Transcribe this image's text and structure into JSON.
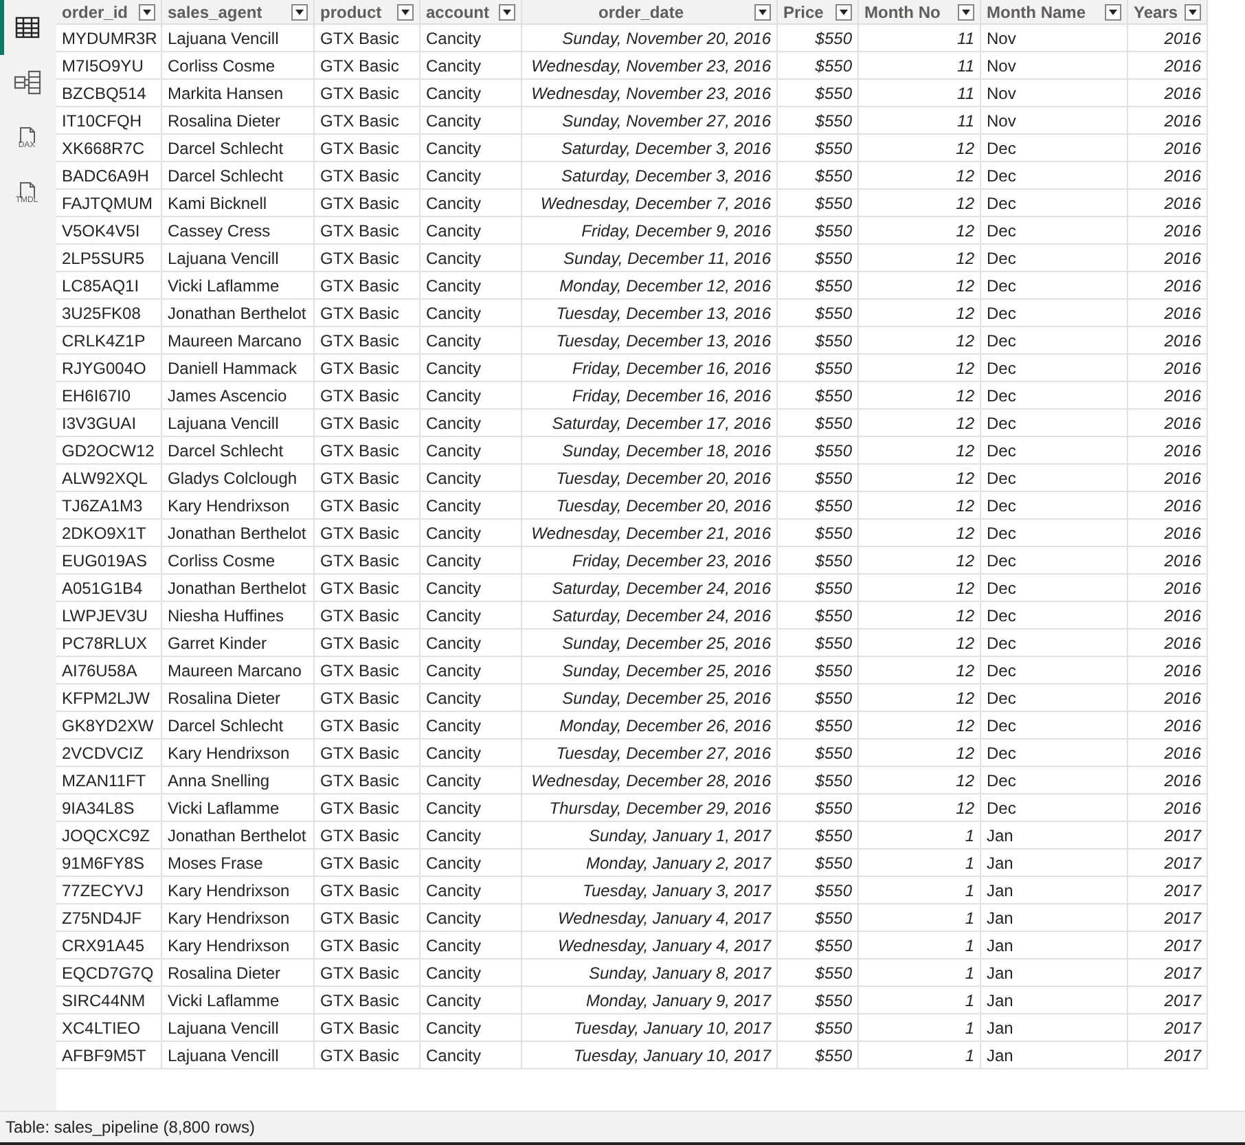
{
  "sidebar": {
    "items": [
      {
        "kind": "table",
        "selected": true
      },
      {
        "kind": "model",
        "selected": false
      },
      {
        "kind": "doc",
        "label": "DAX",
        "selected": false
      },
      {
        "kind": "doc",
        "label": "TMDL",
        "selected": false
      }
    ]
  },
  "table": {
    "columns": [
      {
        "name": "order_id",
        "kind": "text"
      },
      {
        "name": "sales_agent",
        "kind": "text"
      },
      {
        "name": "product",
        "kind": "text"
      },
      {
        "name": "account",
        "kind": "text"
      },
      {
        "name": "order_date",
        "kind": "date"
      },
      {
        "name": "Price",
        "kind": "number"
      },
      {
        "name": "Month No",
        "kind": "number"
      },
      {
        "name": "Month Name",
        "kind": "text"
      },
      {
        "name": "Years",
        "kind": "number"
      }
    ],
    "rows": [
      [
        "MYDUMR3R",
        "Lajuana Vencill",
        "GTX Basic",
        "Cancity",
        "Sunday, November 20, 2016",
        "$550",
        "11",
        "Nov",
        "2016"
      ],
      [
        "M7I5O9YU",
        "Corliss Cosme",
        "GTX Basic",
        "Cancity",
        "Wednesday, November 23, 2016",
        "$550",
        "11",
        "Nov",
        "2016"
      ],
      [
        "BZCBQ514",
        "Markita Hansen",
        "GTX Basic",
        "Cancity",
        "Wednesday, November 23, 2016",
        "$550",
        "11",
        "Nov",
        "2016"
      ],
      [
        "IT10CFQH",
        "Rosalina Dieter",
        "GTX Basic",
        "Cancity",
        "Sunday, November 27, 2016",
        "$550",
        "11",
        "Nov",
        "2016"
      ],
      [
        "XK668R7C",
        "Darcel Schlecht",
        "GTX Basic",
        "Cancity",
        "Saturday, December 3, 2016",
        "$550",
        "12",
        "Dec",
        "2016"
      ],
      [
        "BADC6A9H",
        "Darcel Schlecht",
        "GTX Basic",
        "Cancity",
        "Saturday, December 3, 2016",
        "$550",
        "12",
        "Dec",
        "2016"
      ],
      [
        "FAJTQMUM",
        "Kami Bicknell",
        "GTX Basic",
        "Cancity",
        "Wednesday, December 7, 2016",
        "$550",
        "12",
        "Dec",
        "2016"
      ],
      [
        "V5OK4V5I",
        "Cassey Cress",
        "GTX Basic",
        "Cancity",
        "Friday, December 9, 2016",
        "$550",
        "12",
        "Dec",
        "2016"
      ],
      [
        "2LP5SUR5",
        "Lajuana Vencill",
        "GTX Basic",
        "Cancity",
        "Sunday, December 11, 2016",
        "$550",
        "12",
        "Dec",
        "2016"
      ],
      [
        "LC85AQ1I",
        "Vicki Laflamme",
        "GTX Basic",
        "Cancity",
        "Monday, December 12, 2016",
        "$550",
        "12",
        "Dec",
        "2016"
      ],
      [
        "3U25FK08",
        "Jonathan Berthelot",
        "GTX Basic",
        "Cancity",
        "Tuesday, December 13, 2016",
        "$550",
        "12",
        "Dec",
        "2016"
      ],
      [
        "CRLK4Z1P",
        "Maureen Marcano",
        "GTX Basic",
        "Cancity",
        "Tuesday, December 13, 2016",
        "$550",
        "12",
        "Dec",
        "2016"
      ],
      [
        "RJYG004O",
        "Daniell Hammack",
        "GTX Basic",
        "Cancity",
        "Friday, December 16, 2016",
        "$550",
        "12",
        "Dec",
        "2016"
      ],
      [
        "EH6I67I0",
        "James Ascencio",
        "GTX Basic",
        "Cancity",
        "Friday, December 16, 2016",
        "$550",
        "12",
        "Dec",
        "2016"
      ],
      [
        "I3V3GUAI",
        "Lajuana Vencill",
        "GTX Basic",
        "Cancity",
        "Saturday, December 17, 2016",
        "$550",
        "12",
        "Dec",
        "2016"
      ],
      [
        "GD2OCW12",
        "Darcel Schlecht",
        "GTX Basic",
        "Cancity",
        "Sunday, December 18, 2016",
        "$550",
        "12",
        "Dec",
        "2016"
      ],
      [
        "ALW92XQL",
        "Gladys Colclough",
        "GTX Basic",
        "Cancity",
        "Tuesday, December 20, 2016",
        "$550",
        "12",
        "Dec",
        "2016"
      ],
      [
        "TJ6ZA1M3",
        "Kary Hendrixson",
        "GTX Basic",
        "Cancity",
        "Tuesday, December 20, 2016",
        "$550",
        "12",
        "Dec",
        "2016"
      ],
      [
        "2DKO9X1T",
        "Jonathan Berthelot",
        "GTX Basic",
        "Cancity",
        "Wednesday, December 21, 2016",
        "$550",
        "12",
        "Dec",
        "2016"
      ],
      [
        "EUG019AS",
        "Corliss Cosme",
        "GTX Basic",
        "Cancity",
        "Friday, December 23, 2016",
        "$550",
        "12",
        "Dec",
        "2016"
      ],
      [
        "A051G1B4",
        "Jonathan Berthelot",
        "GTX Basic",
        "Cancity",
        "Saturday, December 24, 2016",
        "$550",
        "12",
        "Dec",
        "2016"
      ],
      [
        "LWPJEV3U",
        "Niesha Huffines",
        "GTX Basic",
        "Cancity",
        "Saturday, December 24, 2016",
        "$550",
        "12",
        "Dec",
        "2016"
      ],
      [
        "PC78RLUX",
        "Garret Kinder",
        "GTX Basic",
        "Cancity",
        "Sunday, December 25, 2016",
        "$550",
        "12",
        "Dec",
        "2016"
      ],
      [
        "AI76U58A",
        "Maureen Marcano",
        "GTX Basic",
        "Cancity",
        "Sunday, December 25, 2016",
        "$550",
        "12",
        "Dec",
        "2016"
      ],
      [
        "KFPM2LJW",
        "Rosalina Dieter",
        "GTX Basic",
        "Cancity",
        "Sunday, December 25, 2016",
        "$550",
        "12",
        "Dec",
        "2016"
      ],
      [
        "GK8YD2XW",
        "Darcel Schlecht",
        "GTX Basic",
        "Cancity",
        "Monday, December 26, 2016",
        "$550",
        "12",
        "Dec",
        "2016"
      ],
      [
        "2VCDVCIZ",
        "Kary Hendrixson",
        "GTX Basic",
        "Cancity",
        "Tuesday, December 27, 2016",
        "$550",
        "12",
        "Dec",
        "2016"
      ],
      [
        "MZAN11FT",
        "Anna Snelling",
        "GTX Basic",
        "Cancity",
        "Wednesday, December 28, 2016",
        "$550",
        "12",
        "Dec",
        "2016"
      ],
      [
        "9IA34L8S",
        "Vicki Laflamme",
        "GTX Basic",
        "Cancity",
        "Thursday, December 29, 2016",
        "$550",
        "12",
        "Dec",
        "2016"
      ],
      [
        "JOQCXC9Z",
        "Jonathan Berthelot",
        "GTX Basic",
        "Cancity",
        "Sunday, January 1, 2017",
        "$550",
        "1",
        "Jan",
        "2017"
      ],
      [
        "91M6FY8S",
        "Moses Frase",
        "GTX Basic",
        "Cancity",
        "Monday, January 2, 2017",
        "$550",
        "1",
        "Jan",
        "2017"
      ],
      [
        "77ZECYVJ",
        "Kary Hendrixson",
        "GTX Basic",
        "Cancity",
        "Tuesday, January 3, 2017",
        "$550",
        "1",
        "Jan",
        "2017"
      ],
      [
        "Z75ND4JF",
        "Kary Hendrixson",
        "GTX Basic",
        "Cancity",
        "Wednesday, January 4, 2017",
        "$550",
        "1",
        "Jan",
        "2017"
      ],
      [
        "CRX91A45",
        "Kary Hendrixson",
        "GTX Basic",
        "Cancity",
        "Wednesday, January 4, 2017",
        "$550",
        "1",
        "Jan",
        "2017"
      ],
      [
        "EQCD7G7Q",
        "Rosalina Dieter",
        "GTX Basic",
        "Cancity",
        "Sunday, January 8, 2017",
        "$550",
        "1",
        "Jan",
        "2017"
      ],
      [
        "SIRC44NM",
        "Vicki Laflamme",
        "GTX Basic",
        "Cancity",
        "Monday, January 9, 2017",
        "$550",
        "1",
        "Jan",
        "2017"
      ],
      [
        "XC4LTIEO",
        "Lajuana Vencill",
        "GTX Basic",
        "Cancity",
        "Tuesday, January 10, 2017",
        "$550",
        "1",
        "Jan",
        "2017"
      ],
      [
        "AFBF9M5T",
        "Lajuana Vencill",
        "GTX Basic",
        "Cancity",
        "Tuesday, January 10, 2017",
        "$550",
        "1",
        "Jan",
        "2017"
      ]
    ]
  },
  "status_bar": {
    "text": "Table: sales_pipeline (8,800 rows)"
  }
}
